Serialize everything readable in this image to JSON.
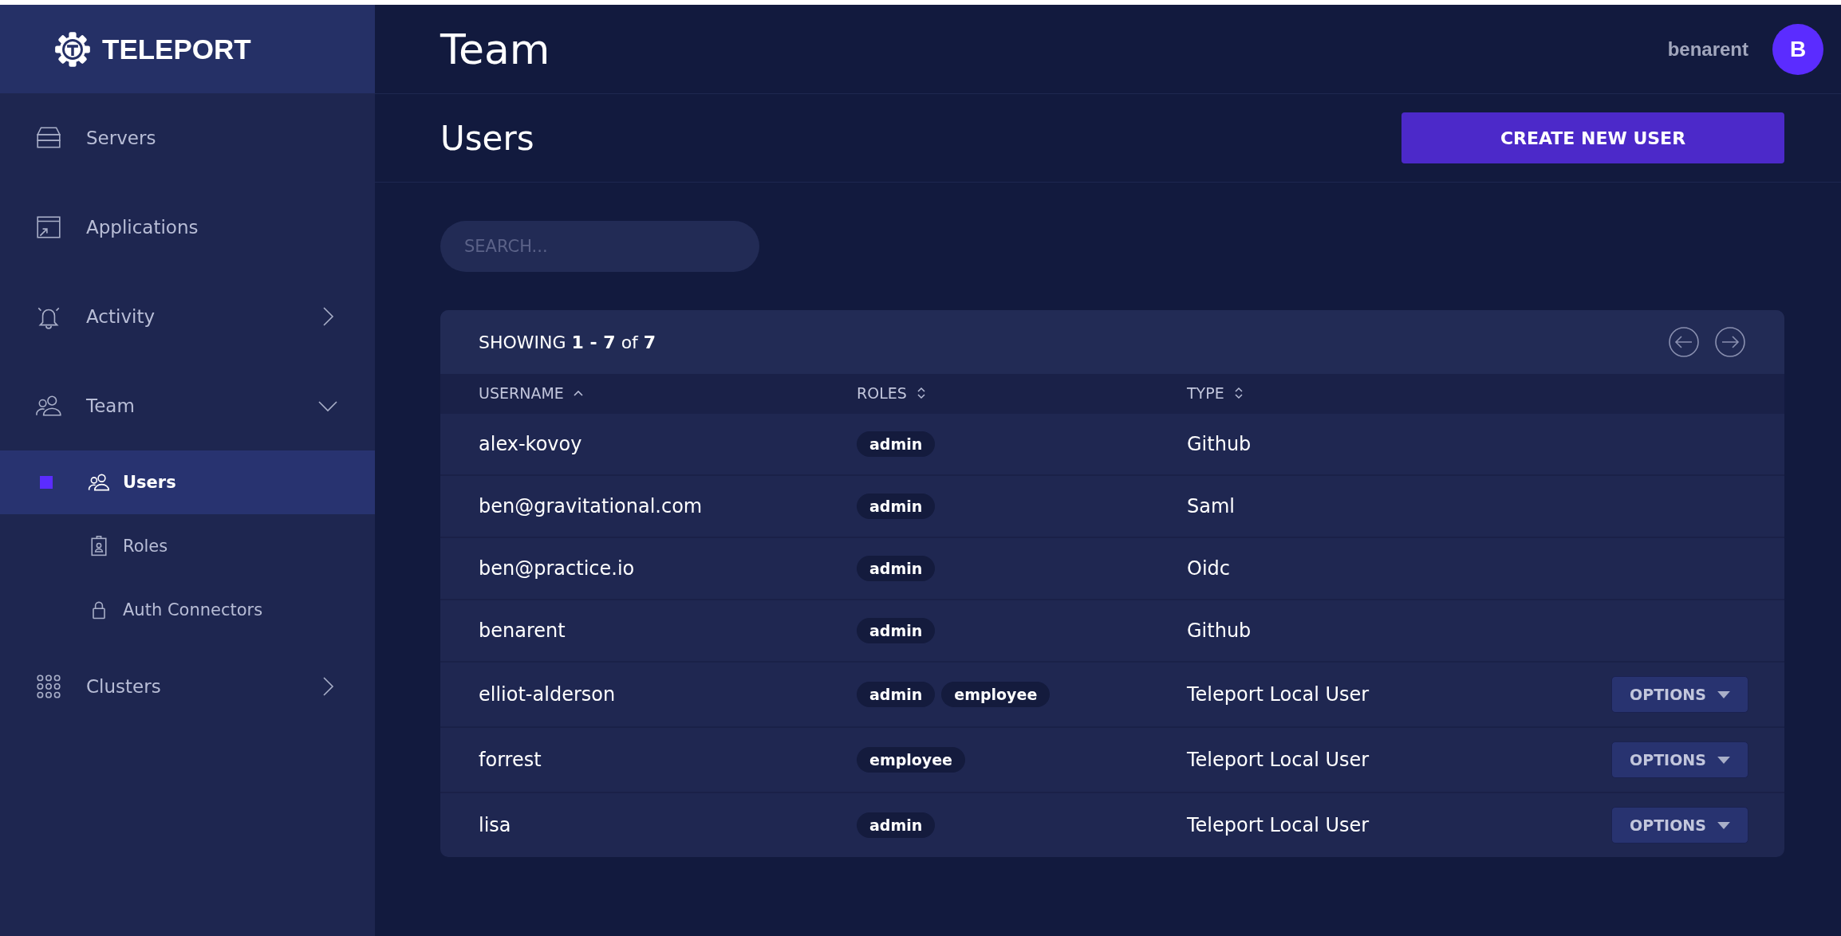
{
  "brand": {
    "name": "TELEPORT"
  },
  "sidebar": {
    "items": [
      {
        "label": "Servers"
      },
      {
        "label": "Applications"
      },
      {
        "label": "Activity",
        "expanded": false
      },
      {
        "label": "Team",
        "expanded": true,
        "children": [
          {
            "label": "Users",
            "selected": true
          },
          {
            "label": "Roles",
            "selected": false
          },
          {
            "label": "Auth Connectors",
            "selected": false
          }
        ]
      },
      {
        "label": "Clusters",
        "expanded": false
      }
    ]
  },
  "header": {
    "title": "Team",
    "username": "benarent",
    "avatar": "B"
  },
  "page": {
    "title": "Users",
    "create_button": "CREATE NEW USER"
  },
  "search": {
    "placeholder": "SEARCH..."
  },
  "table": {
    "showing": "SHOWING **1 - 7** of **7**",
    "columns": [
      {
        "label": "USERNAME",
        "sorted": true
      },
      {
        "label": "ROLES",
        "sorted": false
      },
      {
        "label": "TYPE",
        "sorted": false
      }
    ],
    "rows": [
      {
        "username": "alex-kovoy",
        "roles": [
          "admin"
        ],
        "type": "Github"
      },
      {
        "username": "ben@gravitational.com",
        "roles": [
          "admin"
        ],
        "type": "Saml"
      },
      {
        "username": "ben@practice.io",
        "roles": [
          "admin"
        ],
        "type": "Oidc"
      },
      {
        "username": "benarent",
        "roles": [
          "admin"
        ],
        "type": "Github"
      },
      {
        "username": "elliot-alderson",
        "roles": [
          "admin",
          "employee"
        ],
        "type": "Teleport Local User",
        "action": "OPTIONS"
      },
      {
        "username": "forrest",
        "roles": [
          "employee"
        ],
        "type": "Teleport Local User",
        "action": "OPTIONS"
      },
      {
        "username": "lisa",
        "roles": [
          "admin"
        ],
        "type": "Teleport Local User",
        "action": "OPTIONS"
      }
    ]
  }
}
